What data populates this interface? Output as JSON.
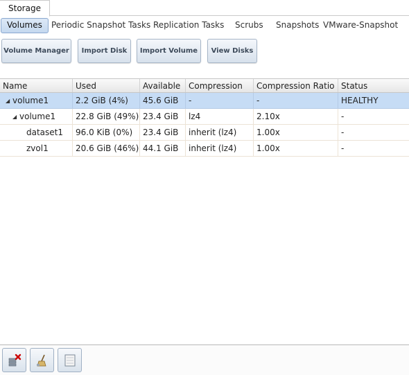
{
  "top_tab": {
    "label": "Storage"
  },
  "subtabs": [
    {
      "label": "Volumes",
      "active": true
    },
    {
      "label": "Periodic Snapshot Tasks",
      "active": false
    },
    {
      "label": "Replication Tasks",
      "active": false
    },
    {
      "label": "Scrubs",
      "active": false
    },
    {
      "label": "Snapshots",
      "active": false
    },
    {
      "label": "VMware-Snapshot",
      "active": false
    }
  ],
  "buttons": [
    {
      "label": "Volume Manager"
    },
    {
      "label": "Import Disk"
    },
    {
      "label": "Import Volume"
    },
    {
      "label": "View Disks"
    }
  ],
  "grid": {
    "columns": [
      "Name",
      "Used",
      "Available",
      "Compression",
      "Compression Ratio",
      "Status"
    ],
    "rows": [
      {
        "level": 0,
        "expander": "◢",
        "selected": true,
        "cells": [
          "volume1",
          "2.2 GiB (4%)",
          "45.6 GiB",
          "-",
          "-",
          "HEALTHY"
        ]
      },
      {
        "level": 1,
        "expander": "◢",
        "selected": false,
        "cells": [
          "volume1",
          "22.8 GiB (49%)",
          "23.4 GiB",
          "lz4",
          "2.10x",
          "-"
        ]
      },
      {
        "level": 2,
        "expander": "",
        "selected": false,
        "cells": [
          "dataset1",
          "96.0 KiB (0%)",
          "23.4 GiB",
          "inherit (lz4)",
          "1.00x",
          "-"
        ]
      },
      {
        "level": 2,
        "expander": "",
        "selected": false,
        "cells": [
          "zvol1",
          "20.6 GiB (46%)",
          "44.1 GiB",
          "inherit (lz4)",
          "1.00x",
          "-"
        ]
      }
    ]
  },
  "toolbar": {
    "icons": [
      "detach-volume-icon",
      "scrub-volume-icon",
      "volume-status-icon"
    ]
  },
  "colors": {
    "selected_row": "#c6dcf5",
    "active_tab": "#c4d8ef",
    "detach_accent": "#cc0000"
  }
}
